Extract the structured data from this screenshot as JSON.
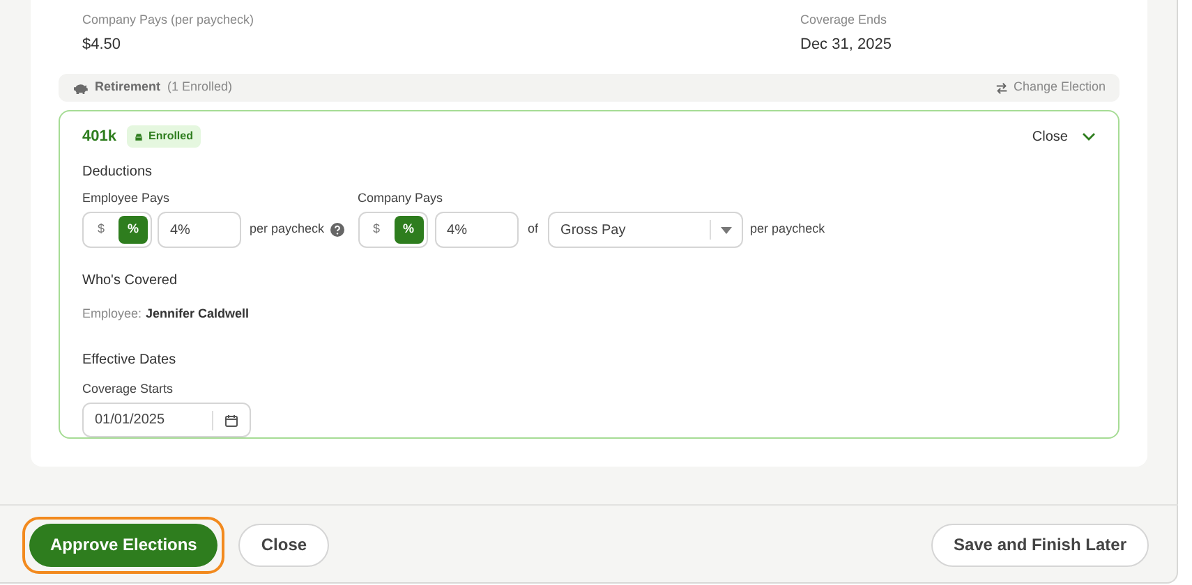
{
  "summary": {
    "left": {
      "label": "Company Pays (per paycheck)",
      "value": "$4.50"
    },
    "right": {
      "label": "Coverage Ends",
      "value": "Dec 31, 2025"
    }
  },
  "section": {
    "title": "Retirement",
    "count": "(1 Enrolled)",
    "action": "Change Election"
  },
  "plan": {
    "name": "401k",
    "badge": "Enrolled",
    "toggle": "Close",
    "expanded": true,
    "deductions_title": "Deductions",
    "employee": {
      "label": "Employee Pays",
      "units": [
        {
          "label": "$",
          "selected": false
        },
        {
          "label": "%",
          "selected": true
        }
      ],
      "value": "4%",
      "suffix": "per paycheck"
    },
    "company": {
      "label": "Company Pays",
      "units": [
        {
          "label": "$",
          "selected": false
        },
        {
          "label": "%",
          "selected": true
        }
      ],
      "value": "4%",
      "of": "of",
      "basis": "Gross Pay",
      "suffix": "per paycheck"
    },
    "covered_title": "Who's Covered",
    "covered_label": "Employee:",
    "covered_name": "Jennifer Caldwell",
    "dates_title": "Effective Dates",
    "start_label": "Coverage Starts",
    "start_value": "01/01/2025"
  },
  "footer": {
    "buttons": [
      {
        "label": "Approve Elections",
        "kind": "primary",
        "focused": true
      },
      {
        "label": "Close",
        "kind": "secondary",
        "focused": false
      },
      {
        "label": "Save and Finish Later",
        "kind": "secondary",
        "focused": false
      }
    ]
  }
}
